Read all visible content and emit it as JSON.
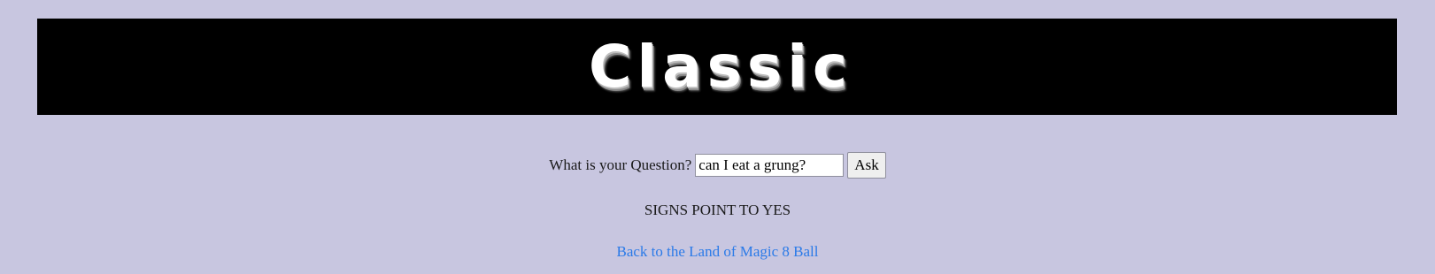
{
  "banner": {
    "title": "Classic"
  },
  "form": {
    "question_label": "What is your Question?",
    "question_value": "can I eat a grung?",
    "ask_label": "Ask"
  },
  "answer": "SIGNS POINT TO YES",
  "back_link": "Back to the Land of Magic 8 Ball",
  "colors": {
    "background": "#c8c6e0",
    "banner_background": "#000000",
    "link": "#2a7ae8"
  }
}
